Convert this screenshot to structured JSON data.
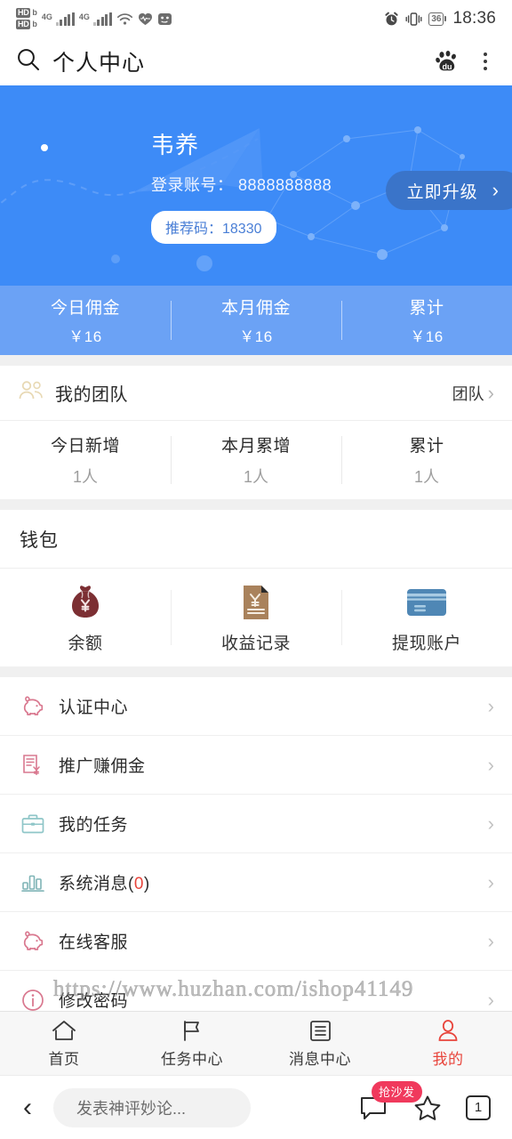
{
  "status_bar": {
    "hd_label": "HD",
    "sim_b": "b",
    "net1": "4G",
    "net2": "4G",
    "wifi_icon": "wifi-icon",
    "heart_icon": "heart-icon",
    "app_icon": "app-icon",
    "alarm_icon": "alarm-icon",
    "vibrate_icon": "vibrate-icon",
    "battery": "36",
    "time": "18:36"
  },
  "title_bar": {
    "search_icon": "search-icon",
    "title": "个人中心",
    "baidu_icon": "baidu-paw-icon",
    "menu_icon": "kebab-menu-icon"
  },
  "hero": {
    "name": "韦养",
    "account_label": "登录账号：",
    "account_value": "8888888888",
    "account_line": "登录账号： 8888888888",
    "referral": "推荐码：18330",
    "upgrade_label": "立即升级",
    "upgrade_chevron": "›",
    "bg_color": "#3d8bf7",
    "button_color": "#3a74c9"
  },
  "commission": {
    "items": [
      {
        "label": "今日佣金",
        "value": "￥16"
      },
      {
        "label": "本月佣金",
        "value": "￥16"
      },
      {
        "label": "累计",
        "value": "￥16"
      }
    ],
    "bg_color": "#6ba2f5"
  },
  "team": {
    "icon": "group-users-icon",
    "title": "我的团队",
    "link_label": "团队",
    "link_arrow": "›",
    "stats": [
      {
        "label": "今日新增",
        "value": "1人"
      },
      {
        "label": "本月累增",
        "value": "1人"
      },
      {
        "label": "累计",
        "value": "1人"
      }
    ]
  },
  "wallet": {
    "title": "钱包",
    "items": [
      {
        "label": "余额",
        "icon": "money-bag-icon",
        "color": "#7c2f33"
      },
      {
        "label": "收益记录",
        "icon": "receipt-yen-icon",
        "color": "#a9825c"
      },
      {
        "label": "提现账户",
        "icon": "bank-card-icon",
        "color": "#4f87b5"
      }
    ]
  },
  "menu": {
    "items": [
      {
        "label": "认证中心",
        "icon": "piggy-bank-icon",
        "color": "#d9788f",
        "arrow": "›",
        "count": ""
      },
      {
        "label": "推广赚佣金",
        "icon": "document-yen-icon",
        "color": "#d9788f",
        "arrow": "›",
        "count": ""
      },
      {
        "label": "我的任务",
        "icon": "briefcase-icon",
        "color": "#8fc6c8",
        "arrow": "›",
        "count": ""
      },
      {
        "label": "系统消息(",
        "icon": "bar-chart-icon",
        "color": "#7fb4b6",
        "arrow": "›",
        "count": "0",
        "label_suffix": ")"
      },
      {
        "label": "在线客服",
        "icon": "piggy-bank-icon",
        "color": "#d9788f",
        "arrow": "›",
        "count": ""
      },
      {
        "label": "修改密码",
        "icon": "info-circle-icon",
        "color": "#d9788f",
        "arrow": "›",
        "count": ""
      }
    ]
  },
  "watermark": {
    "text": "https://www.huzhan.com/ishop41149"
  },
  "tabbar": {
    "items": [
      {
        "label": "首页",
        "icon": "home-icon",
        "active": false
      },
      {
        "label": "任务中心",
        "icon": "flag-icon",
        "active": false
      },
      {
        "label": "消息中心",
        "icon": "list-icon",
        "active": false
      },
      {
        "label": "我的",
        "icon": "person-icon",
        "active": true
      }
    ],
    "active_color": "#e8453c"
  },
  "browser_bar": {
    "back_icon": "back-chevron-icon",
    "comment_placeholder": "发表神评妙论...",
    "comment_icon": "comment-bubble-icon",
    "sofa_badge": "抢沙发",
    "star_icon": "star-icon",
    "tab_count": "1"
  }
}
